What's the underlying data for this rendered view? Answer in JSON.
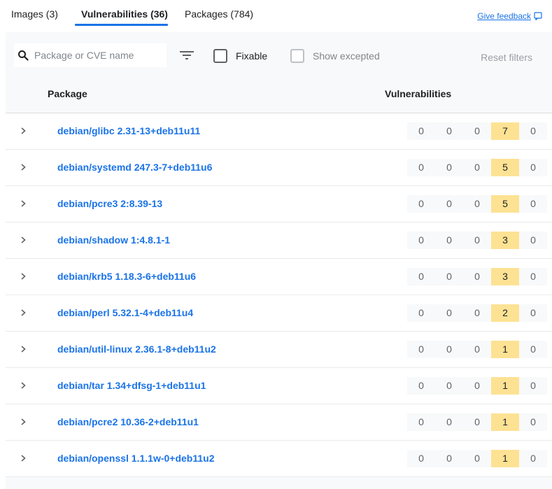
{
  "tabs": [
    {
      "label": "Images (3)"
    },
    {
      "label": "Vulnerabilities (36)"
    },
    {
      "label": "Packages (784)"
    }
  ],
  "feedback": {
    "label": "Give feedback",
    "icon": "feedback-icon"
  },
  "filters": {
    "search_placeholder": "Package or CVE name",
    "search_value": "",
    "fixable_label": "Fixable",
    "fixable_checked": false,
    "show_excepted_label": "Show excepted",
    "show_excepted_checked": false,
    "reset_label": "Reset filters"
  },
  "table": {
    "columns": {
      "package": "Package",
      "vulnerabilities": "Vulnerabilities"
    },
    "rows": [
      {
        "package": "debian/glibc 2.31-13+deb11u11",
        "counts": [
          "0",
          "0",
          "0",
          "7",
          "0"
        ]
      },
      {
        "package": "debian/systemd 247.3-7+deb11u6",
        "counts": [
          "0",
          "0",
          "0",
          "5",
          "0"
        ]
      },
      {
        "package": "debian/pcre3 2:8.39-13",
        "counts": [
          "0",
          "0",
          "0",
          "5",
          "0"
        ]
      },
      {
        "package": "debian/shadow 1:4.8.1-1",
        "counts": [
          "0",
          "0",
          "0",
          "3",
          "0"
        ]
      },
      {
        "package": "debian/krb5 1.18.3-6+deb11u6",
        "counts": [
          "0",
          "0",
          "0",
          "3",
          "0"
        ]
      },
      {
        "package": "debian/perl 5.32.1-4+deb11u4",
        "counts": [
          "0",
          "0",
          "0",
          "2",
          "0"
        ]
      },
      {
        "package": "debian/util-linux 2.36.1-8+deb11u2",
        "counts": [
          "0",
          "0",
          "0",
          "1",
          "0"
        ]
      },
      {
        "package": "debian/tar 1.34+dfsg-1+deb11u1",
        "counts": [
          "0",
          "0",
          "0",
          "1",
          "0"
        ]
      },
      {
        "package": "debian/pcre2 10.36-2+deb11u1",
        "counts": [
          "0",
          "0",
          "0",
          "1",
          "0"
        ]
      },
      {
        "package": "debian/openssl 1.1.1w-0+deb11u2",
        "counts": [
          "0",
          "0",
          "0",
          "1",
          "0"
        ]
      }
    ]
  },
  "colors": {
    "accent": "#1a73e8",
    "highlight_count": "#fde293"
  }
}
